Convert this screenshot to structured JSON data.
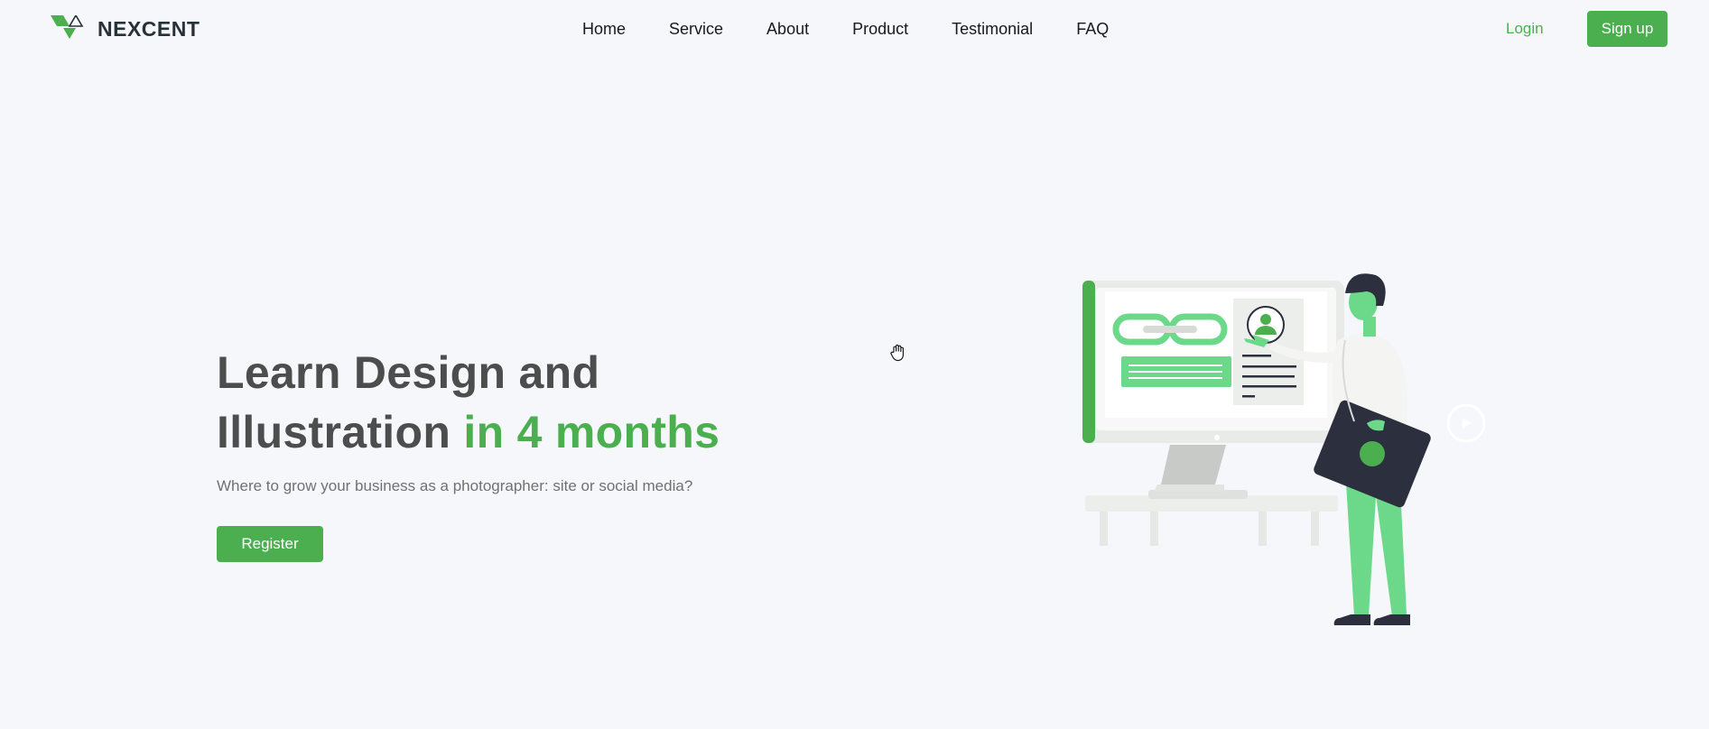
{
  "brand": {
    "name": "NEXCENT",
    "logo_icon": "nexcent-logo-icon",
    "colors": {
      "green": "#4caf4f",
      "grey": "#263238"
    }
  },
  "nav": {
    "links": [
      "Home",
      "Service",
      "About",
      "Product",
      "Testimonial",
      "FAQ"
    ],
    "login_label": "Login",
    "signup_label": "Sign up"
  },
  "hero": {
    "title_part1": "Learn Design and Illustration",
    "title_accent": "in 4 months",
    "subtitle": "Where to grow your business as a photographer: site or social media?",
    "register_label": "Register",
    "illustration": "man-presenting-at-monitor-illustration",
    "cursor_icon": "hand-grab-icon"
  },
  "colors": {
    "accent": "#4caf4f",
    "background": "#f5f7fa",
    "heading": "#4d4d4d",
    "body_text": "#717171",
    "nav_text": "#18191f"
  }
}
